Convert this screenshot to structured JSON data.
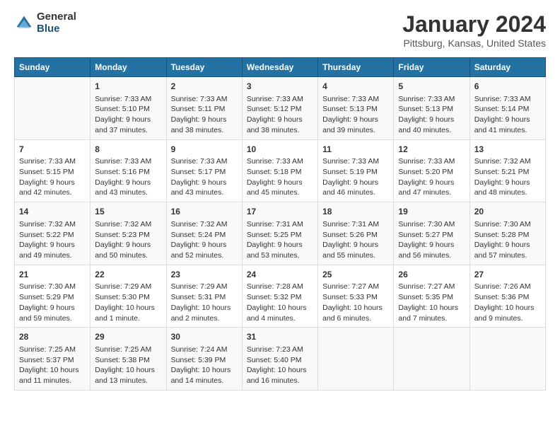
{
  "logo": {
    "general": "General",
    "blue": "Blue"
  },
  "title": "January 2024",
  "subtitle": "Pittsburg, Kansas, United States",
  "headers": [
    "Sunday",
    "Monday",
    "Tuesday",
    "Wednesday",
    "Thursday",
    "Friday",
    "Saturday"
  ],
  "weeks": [
    [
      {
        "day": "",
        "info": ""
      },
      {
        "day": "1",
        "info": "Sunrise: 7:33 AM\nSunset: 5:10 PM\nDaylight: 9 hours\nand 37 minutes."
      },
      {
        "day": "2",
        "info": "Sunrise: 7:33 AM\nSunset: 5:11 PM\nDaylight: 9 hours\nand 38 minutes."
      },
      {
        "day": "3",
        "info": "Sunrise: 7:33 AM\nSunset: 5:12 PM\nDaylight: 9 hours\nand 38 minutes."
      },
      {
        "day": "4",
        "info": "Sunrise: 7:33 AM\nSunset: 5:13 PM\nDaylight: 9 hours\nand 39 minutes."
      },
      {
        "day": "5",
        "info": "Sunrise: 7:33 AM\nSunset: 5:13 PM\nDaylight: 9 hours\nand 40 minutes."
      },
      {
        "day": "6",
        "info": "Sunrise: 7:33 AM\nSunset: 5:14 PM\nDaylight: 9 hours\nand 41 minutes."
      }
    ],
    [
      {
        "day": "7",
        "info": "Sunrise: 7:33 AM\nSunset: 5:15 PM\nDaylight: 9 hours\nand 42 minutes."
      },
      {
        "day": "8",
        "info": "Sunrise: 7:33 AM\nSunset: 5:16 PM\nDaylight: 9 hours\nand 43 minutes."
      },
      {
        "day": "9",
        "info": "Sunrise: 7:33 AM\nSunset: 5:17 PM\nDaylight: 9 hours\nand 43 minutes."
      },
      {
        "day": "10",
        "info": "Sunrise: 7:33 AM\nSunset: 5:18 PM\nDaylight: 9 hours\nand 45 minutes."
      },
      {
        "day": "11",
        "info": "Sunrise: 7:33 AM\nSunset: 5:19 PM\nDaylight: 9 hours\nand 46 minutes."
      },
      {
        "day": "12",
        "info": "Sunrise: 7:33 AM\nSunset: 5:20 PM\nDaylight: 9 hours\nand 47 minutes."
      },
      {
        "day": "13",
        "info": "Sunrise: 7:32 AM\nSunset: 5:21 PM\nDaylight: 9 hours\nand 48 minutes."
      }
    ],
    [
      {
        "day": "14",
        "info": "Sunrise: 7:32 AM\nSunset: 5:22 PM\nDaylight: 9 hours\nand 49 minutes."
      },
      {
        "day": "15",
        "info": "Sunrise: 7:32 AM\nSunset: 5:23 PM\nDaylight: 9 hours\nand 50 minutes."
      },
      {
        "day": "16",
        "info": "Sunrise: 7:32 AM\nSunset: 5:24 PM\nDaylight: 9 hours\nand 52 minutes."
      },
      {
        "day": "17",
        "info": "Sunrise: 7:31 AM\nSunset: 5:25 PM\nDaylight: 9 hours\nand 53 minutes."
      },
      {
        "day": "18",
        "info": "Sunrise: 7:31 AM\nSunset: 5:26 PM\nDaylight: 9 hours\nand 55 minutes."
      },
      {
        "day": "19",
        "info": "Sunrise: 7:30 AM\nSunset: 5:27 PM\nDaylight: 9 hours\nand 56 minutes."
      },
      {
        "day": "20",
        "info": "Sunrise: 7:30 AM\nSunset: 5:28 PM\nDaylight: 9 hours\nand 57 minutes."
      }
    ],
    [
      {
        "day": "21",
        "info": "Sunrise: 7:30 AM\nSunset: 5:29 PM\nDaylight: 9 hours\nand 59 minutes."
      },
      {
        "day": "22",
        "info": "Sunrise: 7:29 AM\nSunset: 5:30 PM\nDaylight: 10 hours\nand 1 minute."
      },
      {
        "day": "23",
        "info": "Sunrise: 7:29 AM\nSunset: 5:31 PM\nDaylight: 10 hours\nand 2 minutes."
      },
      {
        "day": "24",
        "info": "Sunrise: 7:28 AM\nSunset: 5:32 PM\nDaylight: 10 hours\nand 4 minutes."
      },
      {
        "day": "25",
        "info": "Sunrise: 7:27 AM\nSunset: 5:33 PM\nDaylight: 10 hours\nand 6 minutes."
      },
      {
        "day": "26",
        "info": "Sunrise: 7:27 AM\nSunset: 5:35 PM\nDaylight: 10 hours\nand 7 minutes."
      },
      {
        "day": "27",
        "info": "Sunrise: 7:26 AM\nSunset: 5:36 PM\nDaylight: 10 hours\nand 9 minutes."
      }
    ],
    [
      {
        "day": "28",
        "info": "Sunrise: 7:25 AM\nSunset: 5:37 PM\nDaylight: 10 hours\nand 11 minutes."
      },
      {
        "day": "29",
        "info": "Sunrise: 7:25 AM\nSunset: 5:38 PM\nDaylight: 10 hours\nand 13 minutes."
      },
      {
        "day": "30",
        "info": "Sunrise: 7:24 AM\nSunset: 5:39 PM\nDaylight: 10 hours\nand 14 minutes."
      },
      {
        "day": "31",
        "info": "Sunrise: 7:23 AM\nSunset: 5:40 PM\nDaylight: 10 hours\nand 16 minutes."
      },
      {
        "day": "",
        "info": ""
      },
      {
        "day": "",
        "info": ""
      },
      {
        "day": "",
        "info": ""
      }
    ]
  ]
}
